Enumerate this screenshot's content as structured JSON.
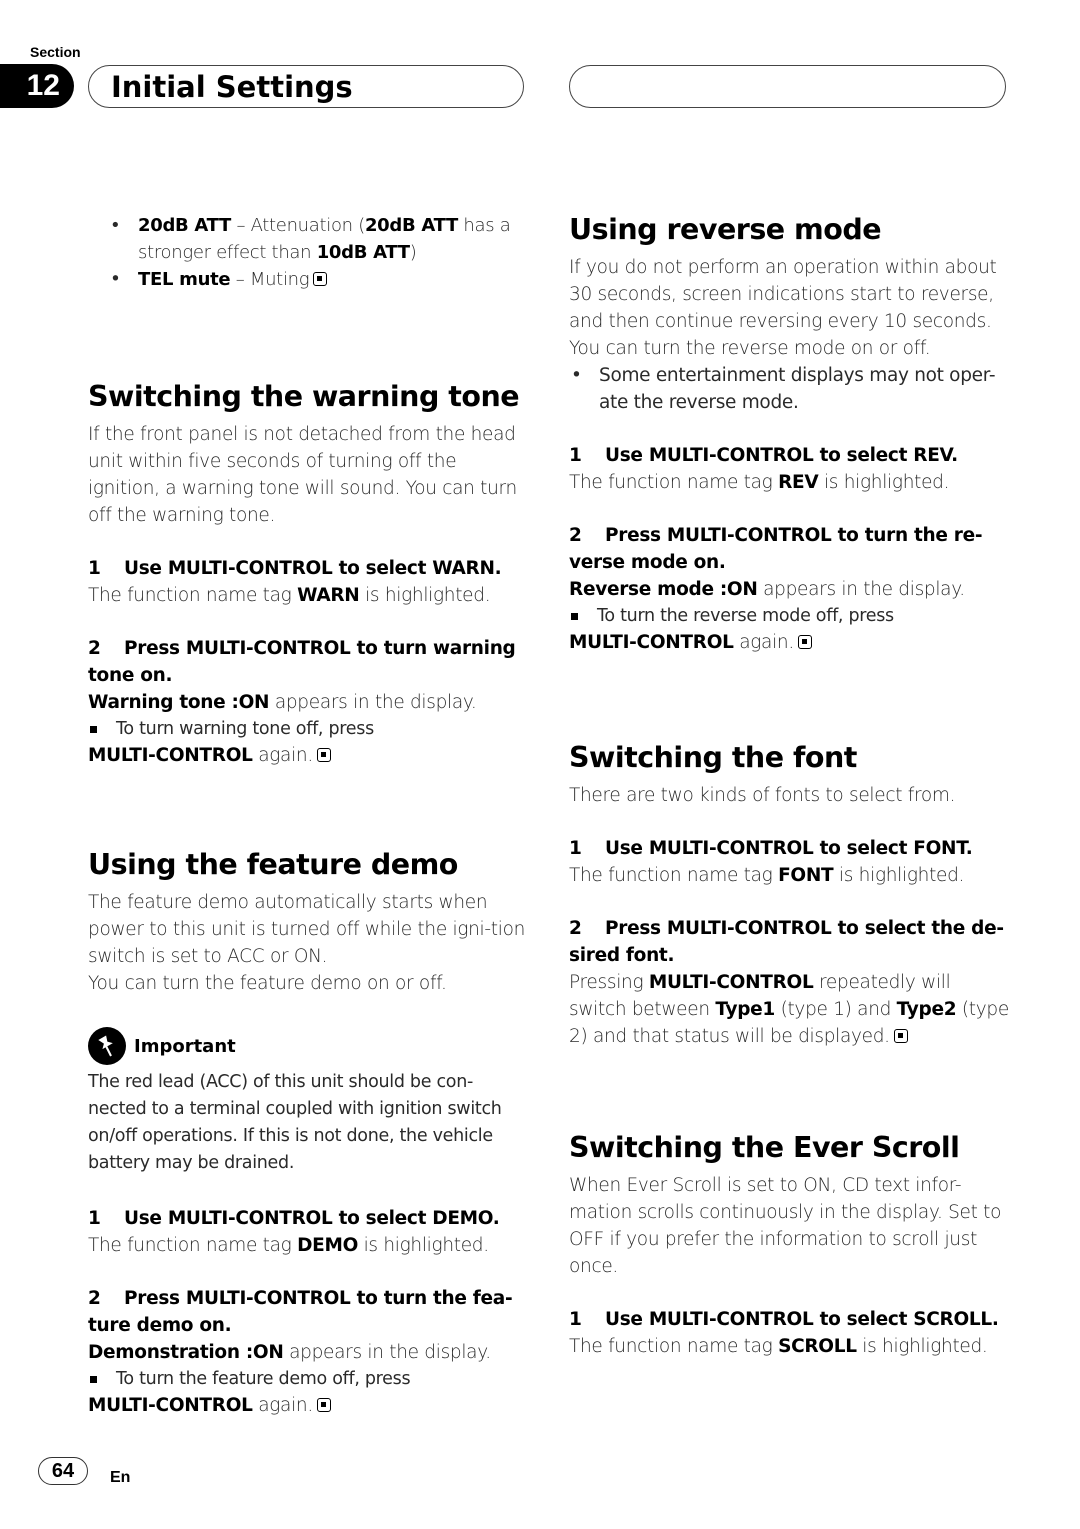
{
  "header": {
    "section_label": "Section",
    "section_number": "12",
    "title": "Initial Settings"
  },
  "left": {
    "att_list": [
      {
        "term": "20dB ATT",
        "dash": " – ",
        "desc_pre": "Attenuation (",
        "desc_bold": "20dB ATT",
        "desc_mid": " has a stronger effect than ",
        "desc_bold2": "10dB ATT",
        "desc_post": ")"
      },
      {
        "term": "TEL mute",
        "dash": " – ",
        "desc": "Muting"
      }
    ],
    "warning": {
      "heading": "Switching the warning tone",
      "intro": "If the front panel is not detached from the head unit within five seconds of turning off the ignition, a warning tone will sound. You can turn off the warning tone.",
      "step1_num": "1",
      "step1": "Use MULTI-CONTROL to select WARN.",
      "step1_pre": "The function name tag ",
      "step1_tag": "WARN",
      "step1_post": " is highlighted.",
      "step2_num": "2",
      "step2": "Press MULTI-CONTROL to turn warning tone on.",
      "display_bold": "Warning tone :ON",
      "display_post": " appears in the display.",
      "note": "To turn warning tone off, press",
      "note_bold": "MULTI-CONTROL",
      "note_post": " again."
    },
    "demo": {
      "heading": "Using the feature demo",
      "intro1": "The feature demo automatically starts when power to this unit is turned off while the igni-tion switch is set to ACC or ON.",
      "intro2": "You can turn the feature demo on or off.",
      "important_label": "Important",
      "important_text": "The red lead (ACC) of this unit should be con-nected to a terminal coupled with ignition switch on/off operations. If this is not done, the vehicle battery may be drained.",
      "step1_num": "1",
      "step1": "Use MULTI-CONTROL to select DEMO.",
      "step1_pre": "The function name tag ",
      "step1_tag": "DEMO",
      "step1_post": " is highlighted.",
      "step2_num": "2",
      "step2": "Press MULTI-CONTROL to turn the fea-ture demo on.",
      "display_bold": "Demonstration :ON",
      "display_post": " appears in the display.",
      "note": "To turn the feature demo off, press",
      "note_bold": "MULTI-CONTROL",
      "note_post": " again."
    }
  },
  "right": {
    "reverse": {
      "heading": "Using reverse mode",
      "intro1": "If you do not perform an operation within about 30 seconds, screen indications start to reverse, and then continue reversing every 10 seconds.",
      "intro2": "You can turn the reverse mode on or off.",
      "bullet": "Some entertainment displays may not oper-ate the reverse mode.",
      "step1_num": "1",
      "step1": "Use MULTI-CONTROL to select REV.",
      "step1_pre": "The function name tag ",
      "step1_tag": "REV",
      "step1_post": " is highlighted.",
      "step2_num": "2",
      "step2": "Press MULTI-CONTROL to turn the re-verse mode on.",
      "display_bold": "Reverse mode :ON",
      "display_post": " appears in the display.",
      "note": "To turn the reverse mode off, press",
      "note_bold": "MULTI-CONTROL",
      "note_post": " again."
    },
    "font": {
      "heading": "Switching the font",
      "intro": "There are two kinds of fonts to select from.",
      "step1_num": "1",
      "step1": "Use MULTI-CONTROL to select FONT.",
      "step1_pre": "The function name tag ",
      "step1_tag": "FONT",
      "step1_post": " is highlighted.",
      "step2_num": "2",
      "step2": "Press MULTI-CONTROL to select the de-sired font.",
      "body_pre": "Pressing ",
      "body_bold": "MULTI-CONTROL",
      "body_mid": " repeatedly will switch between ",
      "type1": "Type1",
      "type1_desc": " (type 1) and ",
      "type2": "Type2",
      "body_post": " (type 2) and that status will be displayed."
    },
    "scroll": {
      "heading": "Switching the Ever Scroll",
      "intro": "When Ever Scroll is set to ON, CD text infor-mation scrolls continuously in the display. Set to OFF if you prefer the information to scroll just once.",
      "step1_num": "1",
      "step1": "Use MULTI-CONTROL to select SCROLL.",
      "step1_pre": "The function name tag ",
      "step1_tag": "SCROLL",
      "step1_post": " is highlighted."
    }
  },
  "footer": {
    "page_number": "64",
    "language": "En"
  }
}
